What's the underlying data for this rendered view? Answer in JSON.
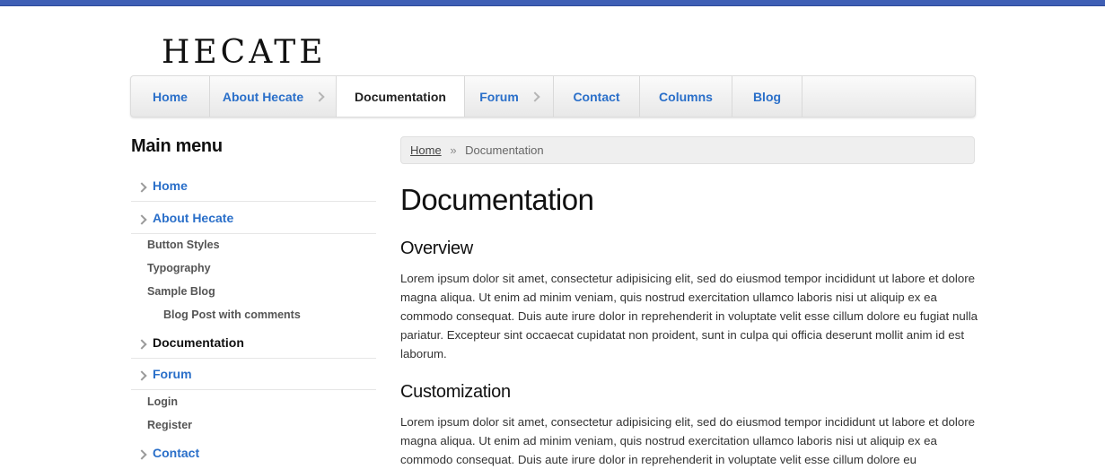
{
  "site": {
    "logo_text": "HECATE"
  },
  "nav": {
    "items": [
      {
        "label": "Home",
        "has_arrow": false,
        "active": false
      },
      {
        "label": "About Hecate",
        "has_arrow": true,
        "active": false
      },
      {
        "label": "Documentation",
        "has_arrow": false,
        "active": true
      },
      {
        "label": "Forum",
        "has_arrow": true,
        "active": false
      },
      {
        "label": "Contact",
        "has_arrow": false,
        "active": false
      },
      {
        "label": "Columns",
        "has_arrow": false,
        "active": false
      },
      {
        "label": "Blog",
        "has_arrow": false,
        "active": false
      }
    ]
  },
  "sidebar": {
    "title": "Main menu",
    "items": [
      {
        "label": "Home"
      },
      {
        "label": "About Hecate"
      },
      {
        "label": "Button Styles"
      },
      {
        "label": "Typography"
      },
      {
        "label": "Sample Blog"
      },
      {
        "label": "Blog Post with comments"
      },
      {
        "label": "Documentation"
      },
      {
        "label": "Forum"
      },
      {
        "label": "Login"
      },
      {
        "label": "Register"
      },
      {
        "label": "Contact"
      }
    ]
  },
  "breadcrumb": {
    "home": "Home",
    "separator": "»",
    "current": "Documentation"
  },
  "content": {
    "title": "Documentation",
    "sections": [
      {
        "heading": "Overview",
        "text": "Lorem ipsum dolor sit amet, consectetur adipisicing elit, sed do eiusmod tempor incididunt ut labore et dolore magna aliqua. Ut enim ad minim veniam, quis nostrud exercitation ullamco laboris nisi ut aliquip ex ea commodo consequat. Duis aute irure dolor in reprehenderit in voluptate velit esse cillum dolore eu fugiat nulla pariatur. Excepteur sint occaecat cupidatat non proident, sunt in culpa qui officia deserunt mollit anim id est laborum."
      },
      {
        "heading": "Customization",
        "text": "Lorem ipsum dolor sit amet, consectetur adipisicing elit, sed do eiusmod tempor incididunt ut labore et dolore magna aliqua. Ut enim ad minim veniam, quis nostrud exercitation ullamco laboris nisi ut aliquip ex ea commodo consequat. Duis aute irure dolor in reprehenderit in voluptate velit esse cillum dolore eu"
      }
    ]
  },
  "colors": {
    "top_bar": "#3f5fb5",
    "link": "#2a6fc9"
  }
}
